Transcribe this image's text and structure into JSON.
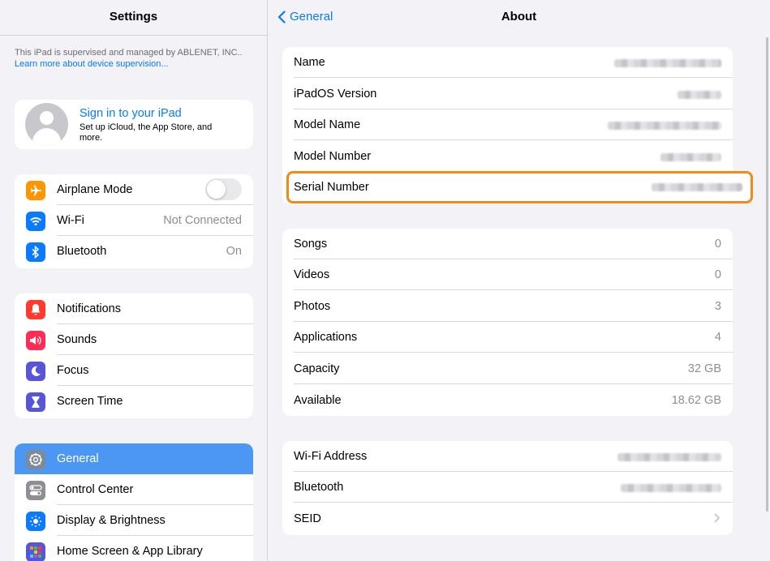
{
  "sidebar": {
    "title": "Settings",
    "supervision_text": "This iPad is supervised and managed by ABLENET, INC..",
    "supervision_link": "Learn more about device supervision...",
    "profile": {
      "title": "Sign in to your iPad",
      "subtitle": "Set up iCloud, the App Store, and more."
    },
    "group1": [
      {
        "label": "Airplane Mode",
        "icon": "airplane-icon",
        "color": "#ff9500",
        "toggle": false
      },
      {
        "label": "Wi-Fi",
        "icon": "wifi-icon",
        "color": "#0a7aff",
        "value": "Not Connected"
      },
      {
        "label": "Bluetooth",
        "icon": "bluetooth-icon",
        "color": "#0a7aff",
        "value": "On"
      }
    ],
    "group2": [
      {
        "label": "Notifications",
        "icon": "bell-icon",
        "color": "#ff3b30"
      },
      {
        "label": "Sounds",
        "icon": "speaker-icon",
        "color": "#ff2d55"
      },
      {
        "label": "Focus",
        "icon": "moon-icon",
        "color": "#5856d6"
      },
      {
        "label": "Screen Time",
        "icon": "hourglass-icon",
        "color": "#5856d6"
      }
    ],
    "group3": [
      {
        "label": "General",
        "icon": "gear-icon",
        "color": "#8e8e93",
        "selected": true
      },
      {
        "label": "Control Center",
        "icon": "switches-icon",
        "color": "#8e8e93"
      },
      {
        "label": "Display & Brightness",
        "icon": "sun-icon",
        "color": "#0a7aff"
      },
      {
        "label": "Home Screen & App Library",
        "icon": "grid-icon",
        "color": "#5856d6"
      }
    ]
  },
  "detail": {
    "back_label": "General",
    "title": "About",
    "group1": [
      {
        "label": "Name"
      },
      {
        "label": "iPadOS Version"
      },
      {
        "label": "Model Name"
      },
      {
        "label": "Model Number"
      },
      {
        "label": "Serial Number"
      }
    ],
    "group2": [
      {
        "label": "Songs",
        "value": "0"
      },
      {
        "label": "Videos",
        "value": "0"
      },
      {
        "label": "Photos",
        "value": "3"
      },
      {
        "label": "Applications",
        "value": "4"
      },
      {
        "label": "Capacity",
        "value": "32 GB"
      },
      {
        "label": "Available",
        "value": "18.62 GB"
      }
    ],
    "group3": [
      {
        "label": "Wi-Fi Address"
      },
      {
        "label": "Bluetooth"
      },
      {
        "label": "SEID"
      }
    ]
  },
  "colors": {
    "accent": "#0a7aff",
    "selected": "#4c97f4",
    "highlight": "#f08a1a"
  }
}
